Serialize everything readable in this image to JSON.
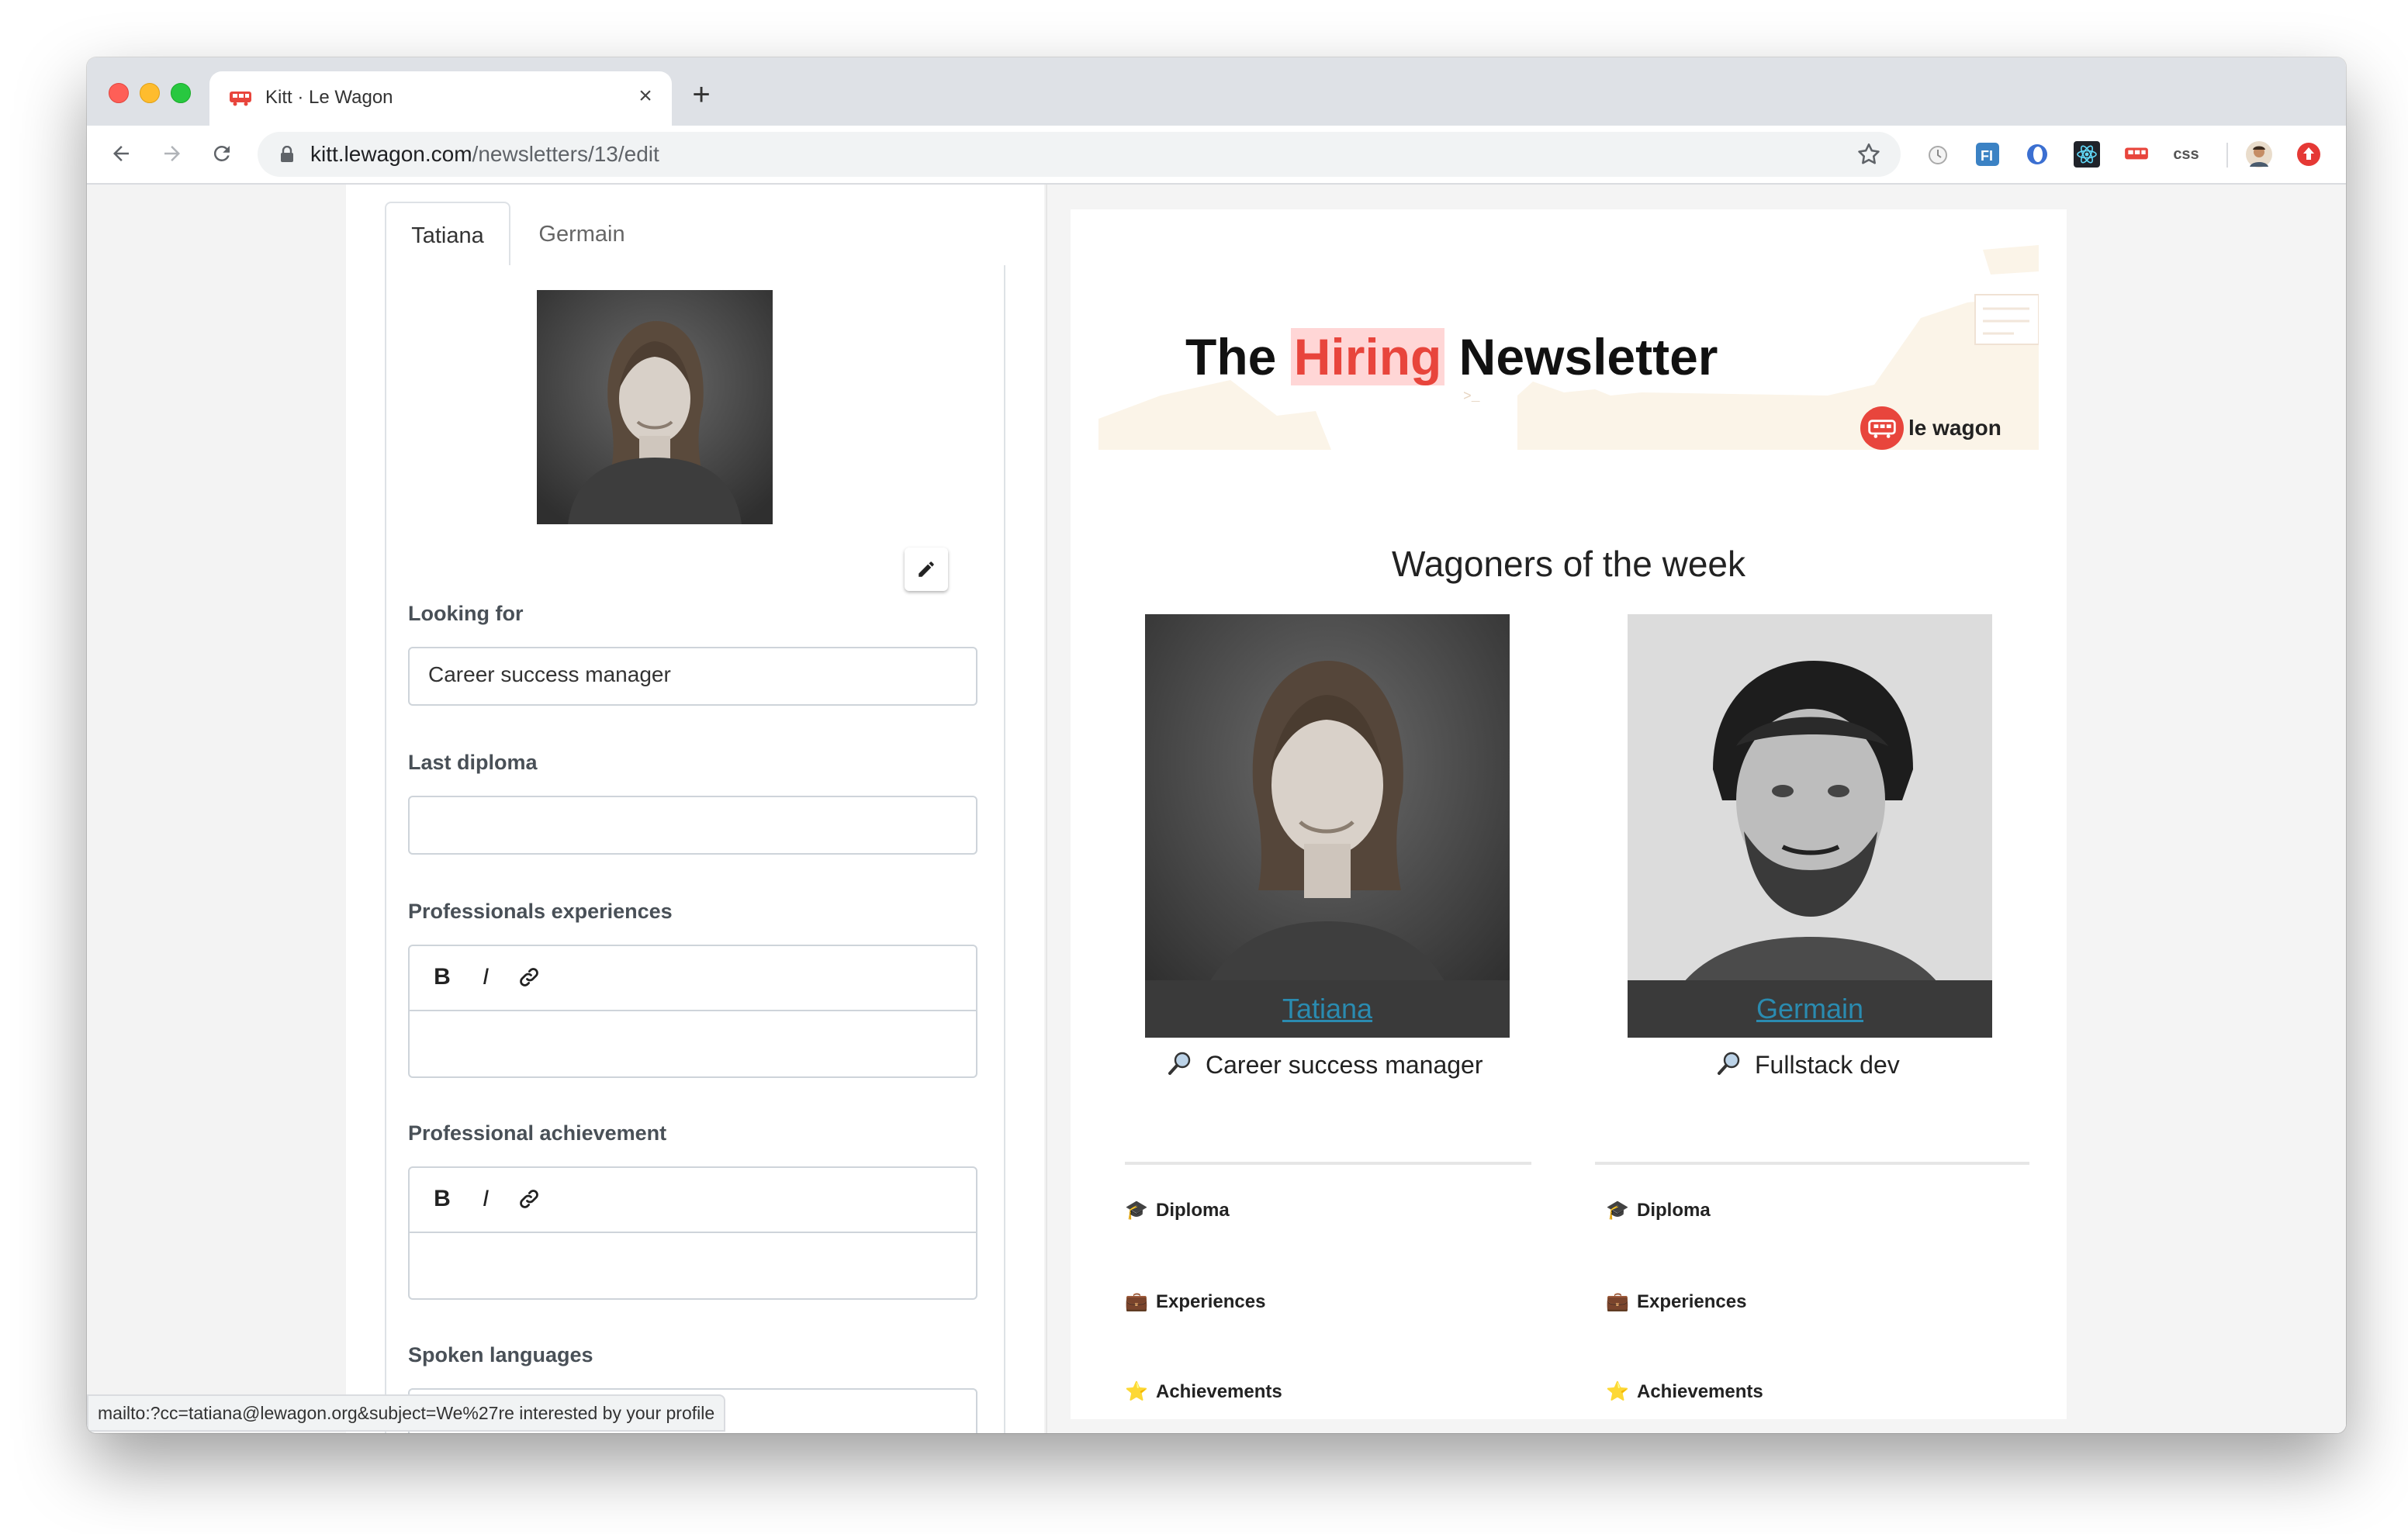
{
  "browser": {
    "tab_title": "Kitt · Le Wagon",
    "url_host": "kitt.lewagon.com",
    "url_path": "/newsletters/13/edit",
    "extensions": [
      "alarm-icon",
      "ff-icon",
      "opera-icon",
      "react-icon",
      "wagon-icon",
      "css-icon",
      "avatar",
      "upload-icon"
    ],
    "ext_css_label": "css"
  },
  "form": {
    "tabs": [
      "Tatiana",
      "Germain"
    ],
    "looking_for_label": "Looking for",
    "looking_for_value": "Career success manager",
    "last_diploma_label": "Last diploma",
    "last_diploma_value": "",
    "professional_experiences_label": "Professionals experiences",
    "professional_achievement_label": "Professional achievement",
    "spoken_languages_label": "Spoken languages",
    "spoken_languages_value": "",
    "editor_buttons": [
      "B",
      "I"
    ]
  },
  "newsletter": {
    "title_pre": "The ",
    "title_highlight": "Hiring",
    "title_post": " Newsletter",
    "brand": "le wagon",
    "section_title": "Wagoners of the week",
    "people": [
      {
        "name": "Tatiana",
        "role": "Career success manager",
        "sections": [
          "Diploma",
          "Experiences",
          "Achievements"
        ]
      },
      {
        "name": "Germain",
        "role": "Fullstack dev",
        "sections": [
          "Diploma",
          "Experiences",
          "Achievements"
        ]
      }
    ]
  },
  "status_bar": "mailto:?cc=tatiana@lewagon.org&subject=We%27re interested by your profile",
  "colors": {
    "accent": "#e8453c",
    "link": "#2a8bb0",
    "highlight_bg": "#ffd6d6"
  }
}
